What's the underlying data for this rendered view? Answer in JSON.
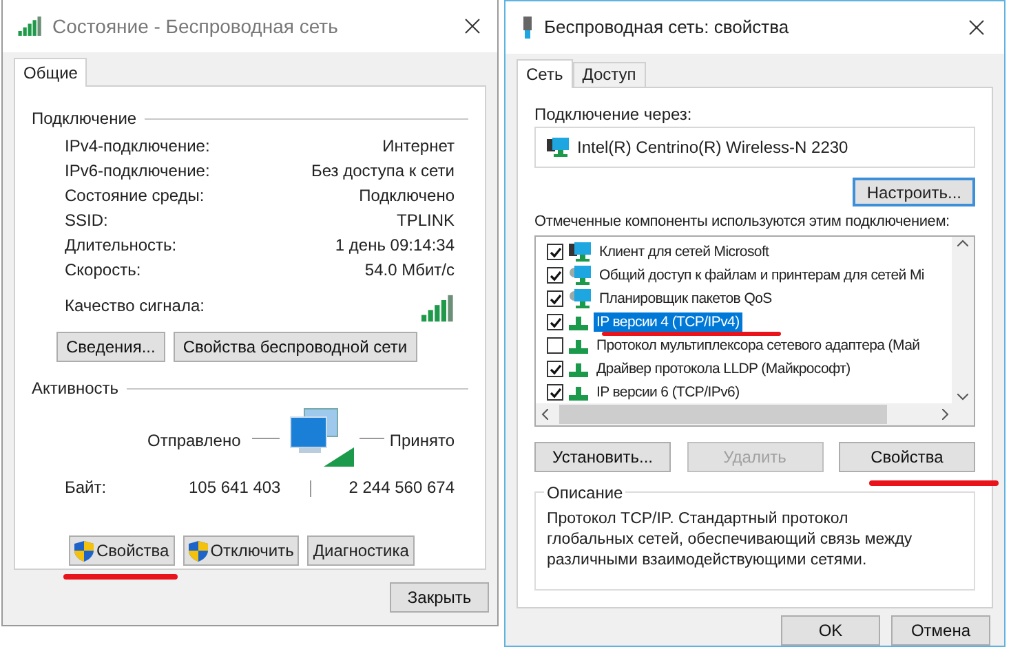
{
  "left_window": {
    "title": "Состояние - Беспроводная сеть",
    "tabs": [
      {
        "label": "Общие",
        "selected": true
      }
    ],
    "connection": {
      "heading": "Подключение",
      "rows": [
        {
          "label": "IPv4-подключение:",
          "value": "Интернет"
        },
        {
          "label": "IPv6-подключение:",
          "value": "Без доступа к сети"
        },
        {
          "label": "Состояние среды:",
          "value": "Подключено"
        },
        {
          "label": "SSID:",
          "value": "TPLINK"
        },
        {
          "label": "Длительность:",
          "value": "1 день 09:14:34"
        },
        {
          "label": "Скорость:",
          "value": "54.0 Мбит/с"
        }
      ],
      "signal_label": "Качество сигнала:"
    },
    "buttons_top": [
      "Сведения...",
      "Свойства беспроводной сети"
    ],
    "activity": {
      "heading": "Активность",
      "sent_label": "Отправлено",
      "received_label": "Принято",
      "bytes_label": "Байт:",
      "bytes_sent": "105 641 403",
      "bytes_received": "2 244 560 674"
    },
    "buttons_bottom": [
      {
        "label": "Свойства",
        "kind": "shield",
        "underlined": true
      },
      {
        "label": "Отключить",
        "kind": "shield",
        "underlined": false
      },
      {
        "label": "Диагностика",
        "kind": "plain",
        "underlined": false
      }
    ],
    "close_button": "Закрыть"
  },
  "right_window": {
    "title": "Беспроводная сеть: свойства",
    "tabs": [
      {
        "label": "Сеть",
        "selected": true
      },
      {
        "label": "Доступ",
        "selected": false
      }
    ],
    "connect_via_label": "Подключение через:",
    "adapter": "Intel(R) Centrino(R) Wireless-N 2230",
    "configure_button": "Настроить...",
    "components_label": "Отмеченные компоненты используются этим подключением:",
    "components": [
      {
        "label": "Клиент для сетей Microsoft",
        "kind": "client",
        "checked": true,
        "selected": false
      },
      {
        "label": "Общий доступ к файлам и принтерам для сетей Mi",
        "kind": "service",
        "checked": true,
        "selected": false
      },
      {
        "label": "Планировщик пакетов QoS",
        "kind": "service",
        "checked": true,
        "selected": false
      },
      {
        "label": "IP версии 4 (TCP/IPv4)",
        "kind": "protocol",
        "checked": true,
        "selected": true
      },
      {
        "label": "Протокол мультиплексора сетевого адаптера (Май",
        "kind": "protocol",
        "checked": false,
        "selected": false
      },
      {
        "label": "Драйвер протокола LLDP (Майкрософт)",
        "kind": "protocol",
        "checked": true,
        "selected": false
      },
      {
        "label": "IP версии 6 (TCP/IPv6)",
        "kind": "protocol",
        "checked": true,
        "selected": false
      }
    ],
    "buttons": [
      {
        "label": "Установить...",
        "disabled": false,
        "underlined": false
      },
      {
        "label": "Удалить",
        "disabled": true,
        "underlined": false
      },
      {
        "label": "Свойства",
        "disabled": false,
        "underlined": true
      }
    ],
    "description_heading": "Описание",
    "description": "Протокол TCP/IP. Стандартный протокол глобальных сетей, обеспечивающий связь между различными взаимодействующими сетями.",
    "ok_button": "OK",
    "cancel_button": "Отмена"
  }
}
